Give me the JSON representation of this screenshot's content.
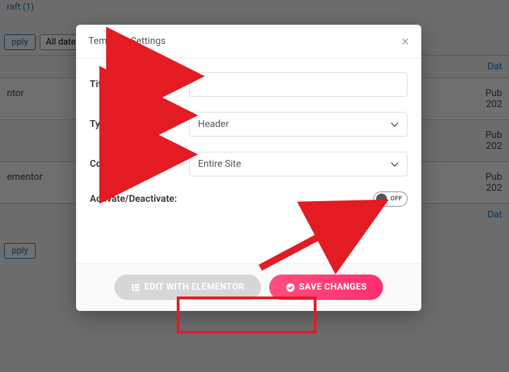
{
  "background": {
    "status": "raft (1)",
    "apply": "pply",
    "all_dates": "All dates",
    "date_col": "Dat",
    "rows": [
      {
        "left": "ntor",
        "pub": "Pub",
        "date": "202"
      },
      {
        "left": "",
        "pub": "Pub",
        "date": "202"
      },
      {
        "left": "ementor",
        "pub": "Pub",
        "date": "202"
      }
    ]
  },
  "modal": {
    "title": "Template Settings",
    "fields": {
      "title_label": "Title:",
      "title_value": "",
      "type_label": "Type:",
      "type_value": "Header",
      "cond_label": "Conditions:",
      "cond_value": "Entire Site",
      "activate_label": "Activate/Deactivate:",
      "toggle_state": "OFF"
    },
    "buttons": {
      "edit": "EDIT WITH ELEMENTOR",
      "save": "SAVE CHANGES"
    }
  },
  "annotations": {
    "color": "#e31b23"
  }
}
